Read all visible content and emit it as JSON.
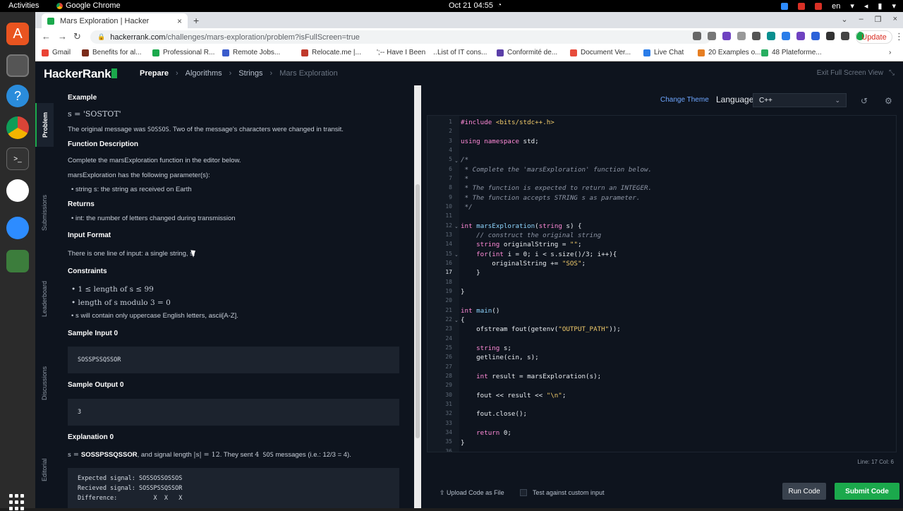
{
  "os": {
    "activities": "Activities",
    "app_name": "Google Chrome",
    "clock": "Oct 21  04:55",
    "locale": "en"
  },
  "browser": {
    "tab_title": "Mars Exploration | Hacker",
    "url_host": "hackerrank.com",
    "url_path": "/challenges/mars-exploration/problem?isFullScreen=true",
    "update_label": "Update",
    "bookmarks": [
      {
        "label": "Gmail",
        "color": "#ea4335"
      },
      {
        "label": "Benefits for al...",
        "color": "#7a2b1a"
      },
      {
        "label": "Professional R...",
        "color": "#1ba94c"
      },
      {
        "label": "Remote Jobs...",
        "color": "#3b5ccc"
      },
      {
        "label": "Relocate.me |...",
        "color": "#c0392b"
      },
      {
        "label": "';-- Have I Been P...",
        "color": "#ffffff"
      },
      {
        "label": "List of IT cons...",
        "color": "#ffffff"
      },
      {
        "label": "Conformité de...",
        "color": "#5b3fa8"
      },
      {
        "label": "Document Ver...",
        "color": "#e74c3c"
      },
      {
        "label": "Live Chat",
        "color": "#2b7de9"
      },
      {
        "label": "20 Examples o...",
        "color": "#e67e22"
      },
      {
        "label": "48 Plateforme...",
        "color": "#27ae60"
      }
    ]
  },
  "header": {
    "logo": "HackerRank",
    "crumbs": [
      "Prepare",
      "Algorithms",
      "Strings",
      "Mars Exploration"
    ],
    "exit_fullscreen": "Exit Full Screen View"
  },
  "vtabs": [
    "Problem",
    "Submissions",
    "Leaderboard",
    "Discussions",
    "Editorial"
  ],
  "problem": {
    "example_heading": "Example",
    "example_s": "s = 'SOSTOT'",
    "original_msg_pre": "The original message was ",
    "original_msg_code": "SOSSOS",
    "original_msg_post": ". Two of the message's characters were changed in transit.",
    "func_desc_heading": "Function Description",
    "func_desc_1": "Complete the marsExploration function in the editor below.",
    "func_desc_2": "marsExploration has the following parameter(s):",
    "func_param": "string s: the string as received on Earth",
    "returns_heading": "Returns",
    "returns_text": "int: the number of letters changed during transmission",
    "input_heading": "Input Format",
    "input_text": "There is one line of input: a single string, s.",
    "constraints_heading": "Constraints",
    "constraint_1": "1 ≤  length of s ≤ 99",
    "constraint_2": "length of s modulo  3 = 0",
    "constraint_3_pre": "s",
    "constraint_3": " will contain only uppercase English letters, ascii[A-Z].",
    "sample_input_heading": "Sample Input 0",
    "sample_input": "SOSSPSSQSSOR",
    "sample_output_heading": "Sample Output 0",
    "sample_output": "3",
    "explanation_heading": "Explanation 0",
    "explanation_pre": "s = ",
    "explanation_s": "SOSSPSSQSSOR",
    "explanation_mid": ", and signal length ",
    "explanation_len": "|s| = 12",
    "explanation_post": ". They sent ",
    "explanation_four": "4",
    "explanation_sos": " SOS",
    "explanation_tail": " messages (i.e.: 12/3 = 4).",
    "expected": "Expected signal: SOSSOSSOSSOS",
    "received": "Recieved signal: SOSSPSSQSSOR",
    "difference": "Difference:          X  X   X"
  },
  "editor": {
    "change_theme": "Change Theme",
    "language_label": "Language",
    "language_value": "C++",
    "line_numbers": [
      "1",
      "2",
      "3",
      "4",
      "5",
      "6",
      "7",
      "8",
      "9",
      "10",
      "11",
      "12",
      "13",
      "14",
      "15",
      "16",
      "17",
      "18",
      "19",
      "20",
      "21",
      "22",
      "23",
      "24",
      "25",
      "26",
      "27",
      "28",
      "29",
      "30",
      "31",
      "32",
      "33",
      "34",
      "35",
      "36"
    ],
    "status": "Line: 17 Col: 6",
    "upload": "Upload Code as File",
    "custom_input": "Test against custom input",
    "run": "Run Code",
    "submit": "Submit Code"
  },
  "colors": {
    "accent": "#1ba94c",
    "bg": "#0e141e"
  }
}
